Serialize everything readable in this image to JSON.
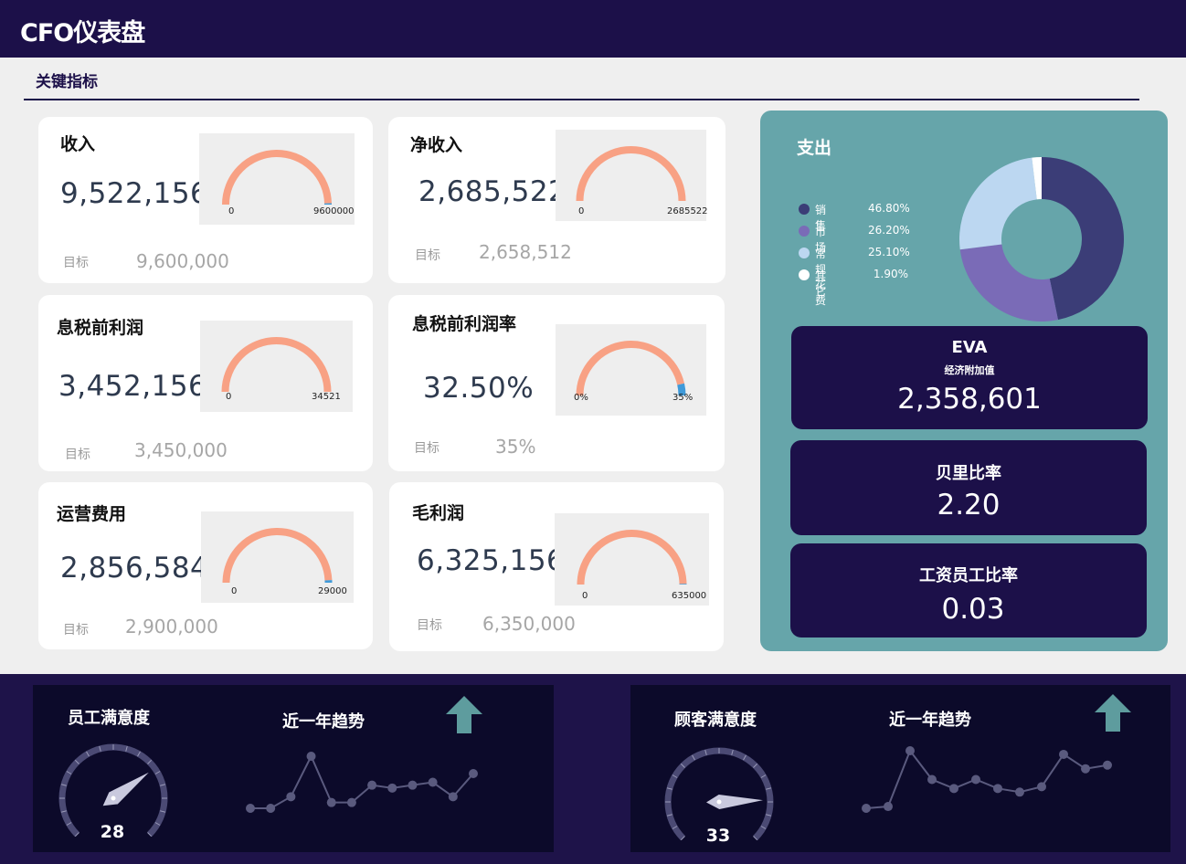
{
  "header": {
    "title": "CFO仪表盘"
  },
  "section": {
    "title": "关键指标"
  },
  "kpis": {
    "revenue": {
      "title": "收入",
      "value": "9,522,156",
      "target_label": "目标",
      "target": "9,600,000",
      "gauge_min": "0",
      "gauge_max": "9600000",
      "progress": 0.992
    },
    "net_income": {
      "title": "净收入",
      "value": "2,685,522",
      "target_label": "目标",
      "target": "2,658,512",
      "gauge_min": "0",
      "gauge_max": "2685522",
      "progress": 1.0
    },
    "ebit": {
      "title": "息税前利润",
      "value": "3,452,156",
      "target_label": "目标",
      "target": "3,450,000",
      "gauge_min": "0",
      "gauge_max": "34521",
      "progress": 1.0
    },
    "ebit_margin": {
      "title": "息税前利润率",
      "value": "32.50%",
      "target_label": "目标",
      "target": "35%",
      "gauge_min": "0%",
      "gauge_max": "35%",
      "progress": 0.929
    },
    "opex": {
      "title": "运营费用",
      "value": "2,856,584",
      "target_label": "目标",
      "target": "2,900,000",
      "gauge_min": "0",
      "gauge_max": "29000",
      "progress": 0.985
    },
    "gross_profit": {
      "title": "毛利润",
      "value": "6,325,156",
      "target_label": "目标",
      "target": "6,350,000",
      "gauge_min": "0",
      "gauge_max": "635000",
      "progress": 0.996
    }
  },
  "expense": {
    "title": "支出",
    "chart_data": {
      "type": "pie",
      "categories": [
        "销售",
        "市场",
        "常规花费",
        "其它"
      ],
      "values": [
        46.8,
        26.2,
        25.1,
        1.9
      ],
      "labels": [
        "46.80%",
        "26.20%",
        "25.10%",
        "1.90%"
      ],
      "colors": [
        "#3b3d77",
        "#7a6bb7",
        "#bcd7f1",
        "#ffffff"
      ]
    }
  },
  "eva": {
    "title": "EVA",
    "subtitle": "经济附加值",
    "value": "2,358,601"
  },
  "berry": {
    "title": "贝里比率",
    "value": "2.20"
  },
  "salary": {
    "title": "工资员工比率",
    "value": "0.03"
  },
  "employee": {
    "title": "员工满意度",
    "value": "28",
    "trend_title": "近一年趋势",
    "chart_data": {
      "type": "line",
      "values": [
        10,
        10,
        12,
        19,
        11,
        11,
        14,
        13.5,
        14,
        14.5,
        12,
        16
      ]
    }
  },
  "customer": {
    "title": "顾客满意度",
    "value": "33",
    "trend_title": "近一年趋势",
    "chart_data": {
      "type": "line",
      "values": [
        12,
        12.5,
        28,
        20,
        17.5,
        20,
        17.5,
        16.5,
        18,
        27,
        23,
        24
      ]
    }
  },
  "colors": {
    "header": "#1c1049",
    "gauge_arc": "#f8a184",
    "gauge_end": "#3f9ad9",
    "panel_bg": "#66a5aa",
    "up_arrow": "#5e9c9e"
  }
}
